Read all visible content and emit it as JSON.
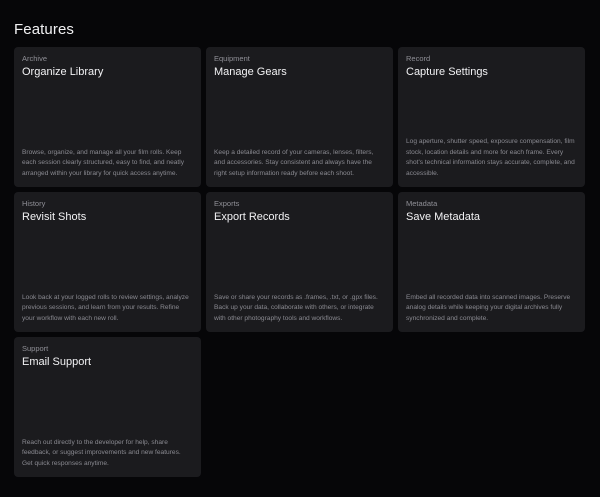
{
  "page": {
    "title": "Features"
  },
  "features": [
    {
      "category": "Archive",
      "title": "Organize Library",
      "description": "Browse, organize, and manage all your film rolls. Keep each session clearly structured, easy to find, and neatly arranged within your library for quick access anytime."
    },
    {
      "category": "Equipment",
      "title": "Manage Gears",
      "description": "Keep a detailed record of your cameras, lenses, filters, and accessories. Stay consistent and always have the right setup information ready before each shoot."
    },
    {
      "category": "Record",
      "title": "Capture Settings",
      "description": "Log aperture, shutter speed, exposure compensation, film stock, location details and more for each frame. Every shot's technical information stays accurate, complete, and accessible."
    },
    {
      "category": "History",
      "title": "Revisit Shots",
      "description": "Look back at your logged rolls to review settings, analyze previous sessions, and learn from your results. Refine your workflow with each new roll."
    },
    {
      "category": "Exports",
      "title": "Export Records",
      "description": "Save or share your records as .frames, .txt, or .gpx files. Back up your data, collaborate with others, or integrate with other photography tools and workflows."
    },
    {
      "category": "Metadata",
      "title": "Save Metadata",
      "description": "Embed all recorded data into scanned images. Preserve analog details while keeping your digital archives fully synchronized and complete."
    },
    {
      "category": "Support",
      "title": "Email Support",
      "description": "Reach out directly to the developer for help, share feedback, or suggest improvements and new features. Get quick responses anytime."
    }
  ]
}
